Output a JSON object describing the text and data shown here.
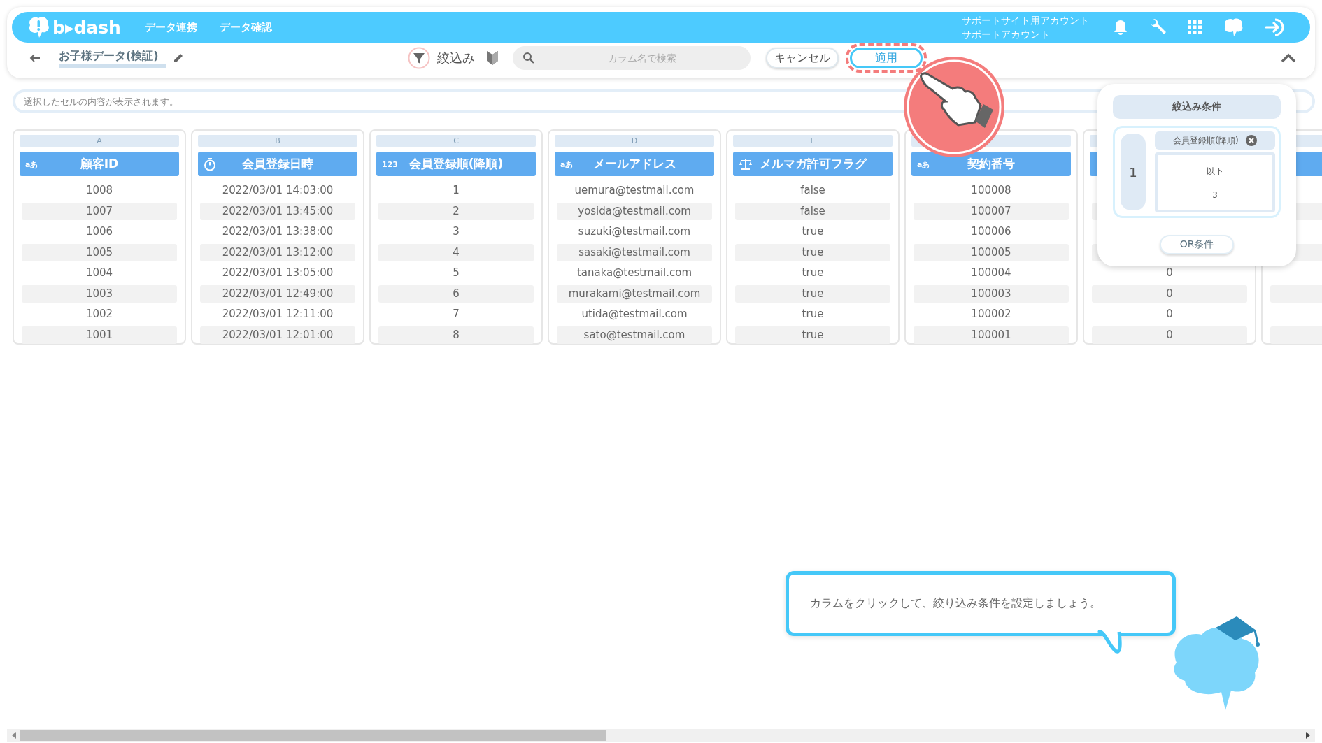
{
  "header": {
    "logo": "b▸dash",
    "nav": [
      "データ連携",
      "データ確認"
    ],
    "account": [
      "サポートサイト用アカウント",
      "サポートアカウント"
    ]
  },
  "toolbar": {
    "title": "お子様データ(検証)",
    "filter_label": "絞込み",
    "search": {
      "placeholder": "カラム名で検索"
    },
    "cancel": "キャンセル",
    "apply": "適用",
    "apply_highlighted": true
  },
  "cell_viewer": {
    "placeholder": "選択したセルの内容が表示されます。"
  },
  "columns": [
    {
      "letter": "A",
      "name": "顧客ID",
      "kind": "text",
      "badge": "aあ",
      "cells": [
        "1008",
        "1007",
        "1006",
        "1005",
        "1004",
        "1003",
        "1002",
        "1001"
      ]
    },
    {
      "letter": "B",
      "name": "会員登録日時",
      "kind": "datetime",
      "cells": [
        "2022/03/01 14:03:00",
        "2022/03/01 13:45:00",
        "2022/03/01 13:38:00",
        "2022/03/01 13:12:00",
        "2022/03/01 13:05:00",
        "2022/03/01 12:49:00",
        "2022/03/01 12:11:00",
        "2022/03/01 12:01:00"
      ]
    },
    {
      "letter": "C",
      "name": "会員登録順(降順)",
      "kind": "number",
      "badge": "123",
      "cells": [
        "1",
        "2",
        "3",
        "4",
        "5",
        "6",
        "7",
        "8"
      ]
    },
    {
      "letter": "D",
      "name": "メールアドレス",
      "kind": "text",
      "badge": "aあ",
      "cells": [
        "uemura@testmail.com",
        "yosida@testmail.com",
        "suzuki@testmail.com",
        "sasaki@testmail.com",
        "tanaka@testmail.com",
        "murakami@testmail.com",
        "utida@testmail.com",
        "sato@testmail.com"
      ]
    },
    {
      "letter": "E",
      "name": "メルマガ許可フラグ",
      "kind": "boolean",
      "cells": [
        "false",
        "false",
        "true",
        "true",
        "true",
        "true",
        "true",
        "true"
      ]
    },
    {
      "name": "契約番号",
      "kind": "text",
      "badge": "aあ",
      "cells": [
        "100008",
        "100007",
        "100006",
        "100005",
        "100004",
        "100003",
        "100002",
        "100001"
      ]
    },
    {
      "kind": "hidden",
      "cells": [
        null,
        null,
        null,
        null,
        "0",
        "0",
        "0",
        "0"
      ]
    },
    {
      "kind": "hidden",
      "cells": [
        null,
        null,
        null,
        null,
        null,
        null,
        null,
        null
      ]
    }
  ],
  "filter_panel": {
    "title": "絞込み条件",
    "groups": [
      {
        "index": "1",
        "conditions": [
          {
            "column": "会員登録順(降順)",
            "operator": "以下",
            "value": "3"
          }
        ]
      }
    ],
    "or_button": "OR条件"
  },
  "tip": {
    "text": "カラムをクリックして、絞り込み条件を設定しましょう。"
  }
}
